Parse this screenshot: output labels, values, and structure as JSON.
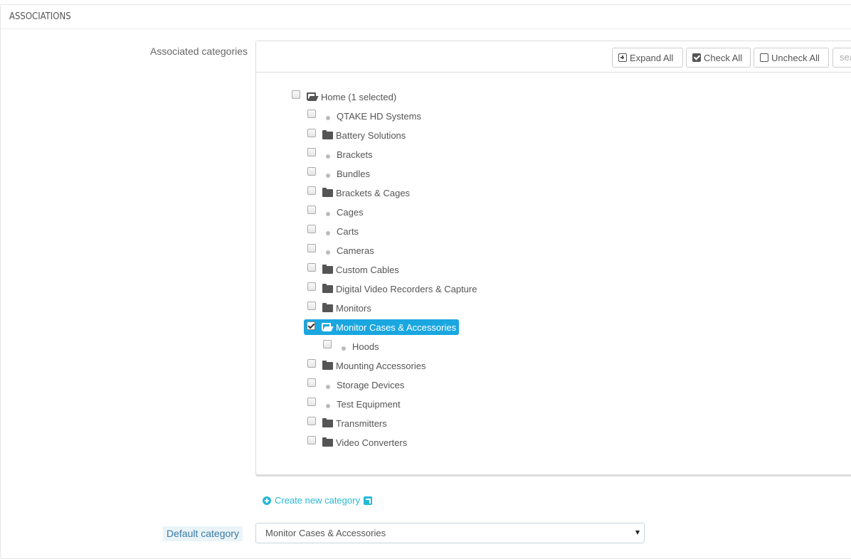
{
  "section": {
    "title": "ASSOCIATIONS"
  },
  "associated_categories": {
    "label": "Associated categories",
    "toolbar": {
      "expand_all": "Expand All",
      "check_all": "Check All",
      "uncheck_all": "Uncheck All",
      "search_placeholder": "search..."
    },
    "tree": {
      "root": {
        "label": "Home (1 selected)",
        "checked": false,
        "icon": "folder-open-icon"
      },
      "items": [
        {
          "label": "QTAKE HD Systems",
          "checked": false,
          "icon": "leaf-dot"
        },
        {
          "label": "Battery Solutions",
          "checked": false,
          "icon": "folder-icon"
        },
        {
          "label": "Brackets",
          "checked": false,
          "icon": "leaf-dot"
        },
        {
          "label": "Bundles",
          "checked": false,
          "icon": "leaf-dot"
        },
        {
          "label": "Brackets & Cages",
          "checked": false,
          "icon": "folder-icon"
        },
        {
          "label": "Cages",
          "checked": false,
          "icon": "leaf-dot"
        },
        {
          "label": "Carts",
          "checked": false,
          "icon": "leaf-dot"
        },
        {
          "label": "Cameras",
          "checked": false,
          "icon": "leaf-dot"
        },
        {
          "label": "Custom Cables",
          "checked": false,
          "icon": "folder-icon"
        },
        {
          "label": "Digital Video Recorders & Capture",
          "checked": false,
          "icon": "folder-icon"
        },
        {
          "label": "Monitors",
          "checked": false,
          "icon": "folder-icon"
        },
        {
          "label": "Monitor Cases & Accessories",
          "checked": true,
          "icon": "folder-open-icon",
          "selected": true
        },
        {
          "label": "Hoods",
          "checked": false,
          "icon": "leaf-dot",
          "child": true
        },
        {
          "label": "Mounting Accessories",
          "checked": false,
          "icon": "folder-icon"
        },
        {
          "label": "Storage Devices",
          "checked": false,
          "icon": "leaf-dot"
        },
        {
          "label": "Test Equipment",
          "checked": false,
          "icon": "leaf-dot"
        },
        {
          "label": "Transmitters",
          "checked": false,
          "icon": "folder-icon"
        },
        {
          "label": "Video Converters",
          "checked": false,
          "icon": "folder-icon"
        }
      ]
    }
  },
  "create_link": {
    "label": "Create new category"
  },
  "default_category": {
    "label": "Default category",
    "selected": "Monitor Cases & Accessories"
  },
  "colors": {
    "accent": "#1aa7e0",
    "link": "#25b9d7"
  }
}
